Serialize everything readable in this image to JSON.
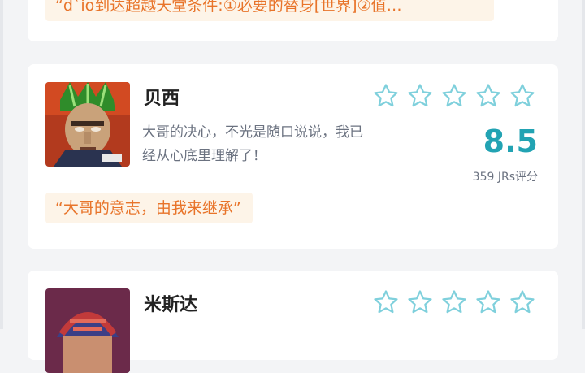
{
  "cards": [
    {
      "quote": "“d`io到达超越天堂条件:①必要的替身[世界]②值…"
    },
    {
      "name": "贝西",
      "description": "大哥的决心，不光是随口说说，我已经从心底里理解了！",
      "rating_value": "8.5",
      "raters": "359 JRs评分",
      "quote": "“大哥的意志，由我来继承”",
      "star_count": 5,
      "stars_filled": 0,
      "avatar_icon": "character-portrait-green-hair"
    },
    {
      "name": "米斯达",
      "star_count": 5,
      "stars_filled": 0,
      "avatar_icon": "character-portrait-hat"
    }
  ],
  "colors": {
    "accent_teal": "#22a3b3",
    "quote_text": "#e8742a",
    "quote_bg": "#fdf4e8",
    "star_outline": "#7fd0dc"
  }
}
